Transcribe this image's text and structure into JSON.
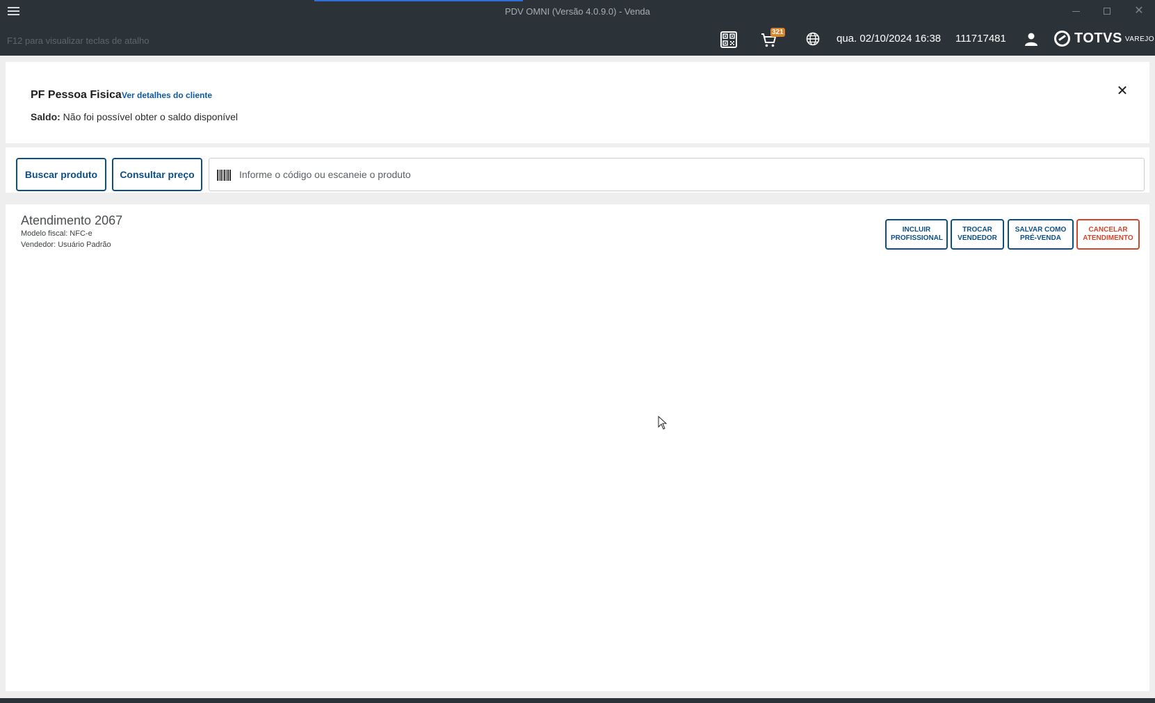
{
  "window": {
    "title": "PDV OMNI (Versão 4.0.9.0) - Venda",
    "menu_icon": "hamburger-menu-icon"
  },
  "header": {
    "shortcut_hint": "F12 para visualizar teclas de atalho",
    "cart_count": "321",
    "datetime": "qua. 02/10/2024 16:38",
    "user_code": "111717481",
    "brand_name": "TOTVS",
    "brand_sub": "VAREJO",
    "icons": [
      "qr-code-icon",
      "cart-icon",
      "globe-icon",
      "user-icon"
    ]
  },
  "client": {
    "name": "PF Pessoa Fisica",
    "details_link": "Ver detalhes do cliente",
    "balance_label": "Saldo:",
    "balance_text": "Não foi possível obter o saldo disponível",
    "close_symbol": "✕"
  },
  "search": {
    "search_product_label": "Buscar produto",
    "check_price_label": "Consultar preço",
    "product_placeholder": "Informe o código ou escaneie o produto"
  },
  "sale": {
    "title": "Atendimento 2067",
    "fiscal_model": "Modelo fiscal: NFC-e",
    "seller": "Vendedor: Usuário Padrão",
    "actions": {
      "include_professional": [
        "INCLUIR",
        "PROFISSIONAL"
      ],
      "change_seller": [
        "TROCAR",
        "VENDEDOR"
      ],
      "save_presale": [
        "SALVAR COMO",
        "PRÉ-VENDA"
      ],
      "cancel_service": [
        "CANCELAR",
        "ATENDIMENTO"
      ]
    }
  },
  "colors": {
    "topbar": "#2c3338",
    "primary": "#0c4e86",
    "danger": "#d6452b",
    "badge": "#d9832b"
  }
}
